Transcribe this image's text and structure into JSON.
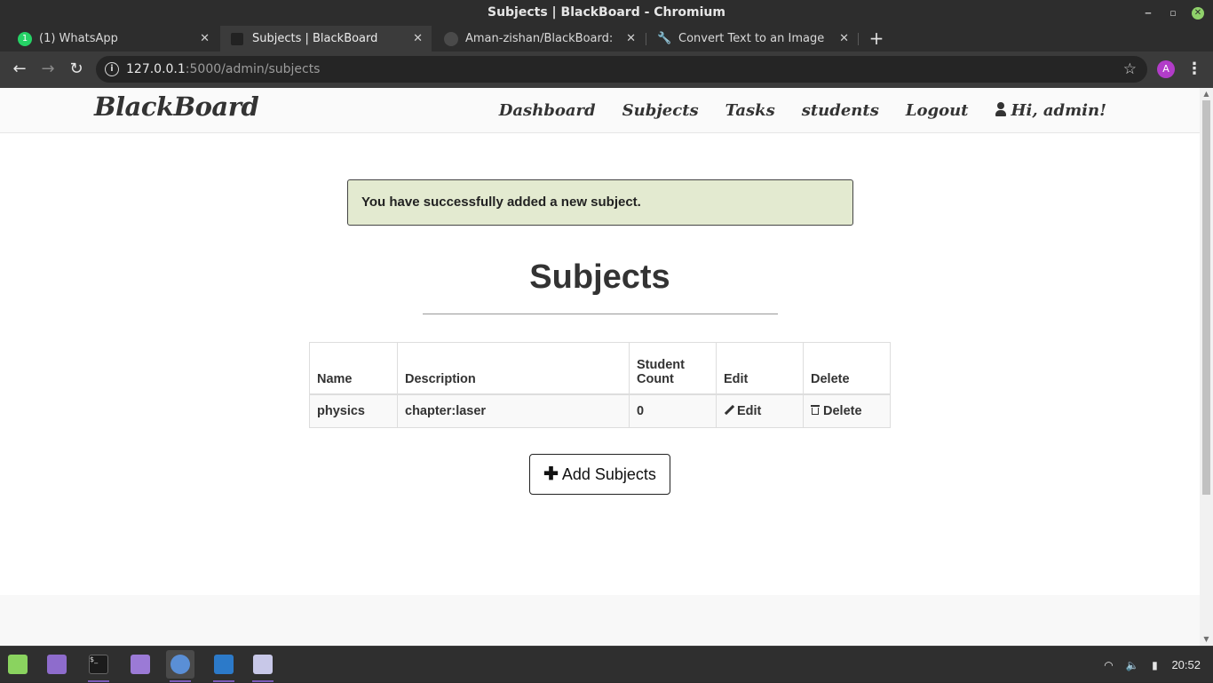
{
  "window": {
    "title": "Subjects | BlackBoard - Chromium",
    "minimize_label": "‒",
    "restore_label": "▫",
    "close_label": "✕"
  },
  "tabs": [
    {
      "title": "(1) WhatsApp",
      "icon": "whatsapp-icon",
      "close": "✕"
    },
    {
      "title": "Subjects | BlackBoard",
      "icon": "blackboard-favicon",
      "close": "✕"
    },
    {
      "title": "Aman-zishan/BlackBoard: class",
      "icon": "github-icon",
      "close": "✕"
    },
    {
      "title": "Convert Text to an Image - Onli",
      "icon": "wrench-icon",
      "close": "✕"
    }
  ],
  "new_tab_label": "+",
  "toolbar": {
    "back": "←",
    "forward": "→",
    "reload": "↻",
    "url_host": "127.0.0.1",
    "url_path": ":5000/admin/subjects",
    "bookmark": "☆",
    "profile_initial": "A",
    "menu": "⋮",
    "info": "i"
  },
  "site": {
    "brand": "BlackBoard",
    "nav": [
      "Dashboard",
      "Subjects",
      "Tasks",
      "students",
      "Logout"
    ],
    "user_greeting": "Hi, admin!"
  },
  "alert": "You have successfully added a new subject.",
  "page_title": "Subjects",
  "table": {
    "headers": [
      "Name",
      "Description",
      "Student Count",
      "Edit",
      "Delete"
    ],
    "rows": [
      {
        "name": "physics",
        "description": "chapter:laser",
        "student_count": "0",
        "edit": "Edit",
        "delete": "Delete"
      }
    ]
  },
  "add_button": "Add Subjects",
  "taskbar": {
    "apps": [
      "mint-menu-icon",
      "files-icon",
      "terminal-icon",
      "folder-icon",
      "chromium-icon",
      "vscode-icon",
      "text-editor-icon"
    ],
    "clock": "20:52",
    "terminal_prompt": "$_",
    "tray": {
      "wifi": "◠",
      "volume": "🔈",
      "battery": "▮"
    }
  },
  "colors": {
    "accent_purple": "#7a5bb8",
    "alert_bg": "#e3ead0",
    "profile": "#b23cc9",
    "whatsapp": "#25d366"
  }
}
